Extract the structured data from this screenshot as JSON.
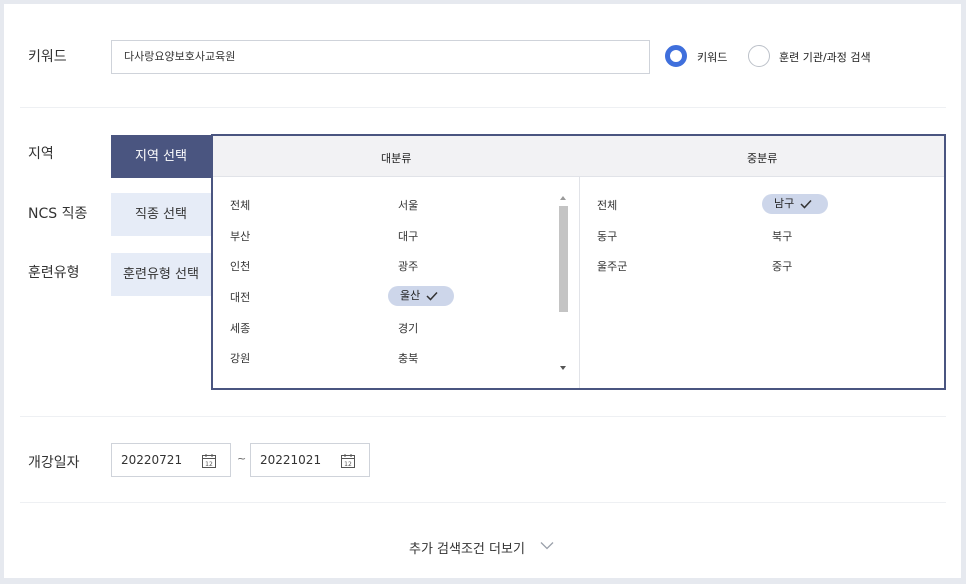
{
  "keyword": {
    "label": "키워드",
    "value": "다사랑요양보호사교육원",
    "radio_keyword": "키워드",
    "radio_org": "훈련 기관/과정 검색"
  },
  "region": {
    "label": "지역",
    "button": "지역 선택"
  },
  "ncs": {
    "label": "NCS 직종",
    "button": "직종 선택"
  },
  "training": {
    "label": "훈련유형",
    "button": "훈련유형 선택"
  },
  "dropdown": {
    "major_header": "대분류",
    "minor_header": "중분류",
    "major_col1": [
      "전체",
      "부산",
      "인천",
      "대전",
      "세종",
      "강원"
    ],
    "major_col2": [
      "서울",
      "대구",
      "광주",
      "울산",
      "경기",
      "충북"
    ],
    "major_selected": "울산",
    "minor_col1": [
      "전체",
      "동구",
      "울주군"
    ],
    "minor_col2": [
      "남구",
      "북구",
      "중구"
    ],
    "minor_selected": "남구"
  },
  "date": {
    "label": "개강일자",
    "start": "20220721",
    "end": "20221021",
    "separator": "~",
    "calendar_day": "12"
  },
  "more": {
    "label": "추가 검색조건 더보기"
  },
  "colors": {
    "accent": "#3f6fdc",
    "active_button": "#4a5580",
    "chip": "#cdd6ea"
  }
}
